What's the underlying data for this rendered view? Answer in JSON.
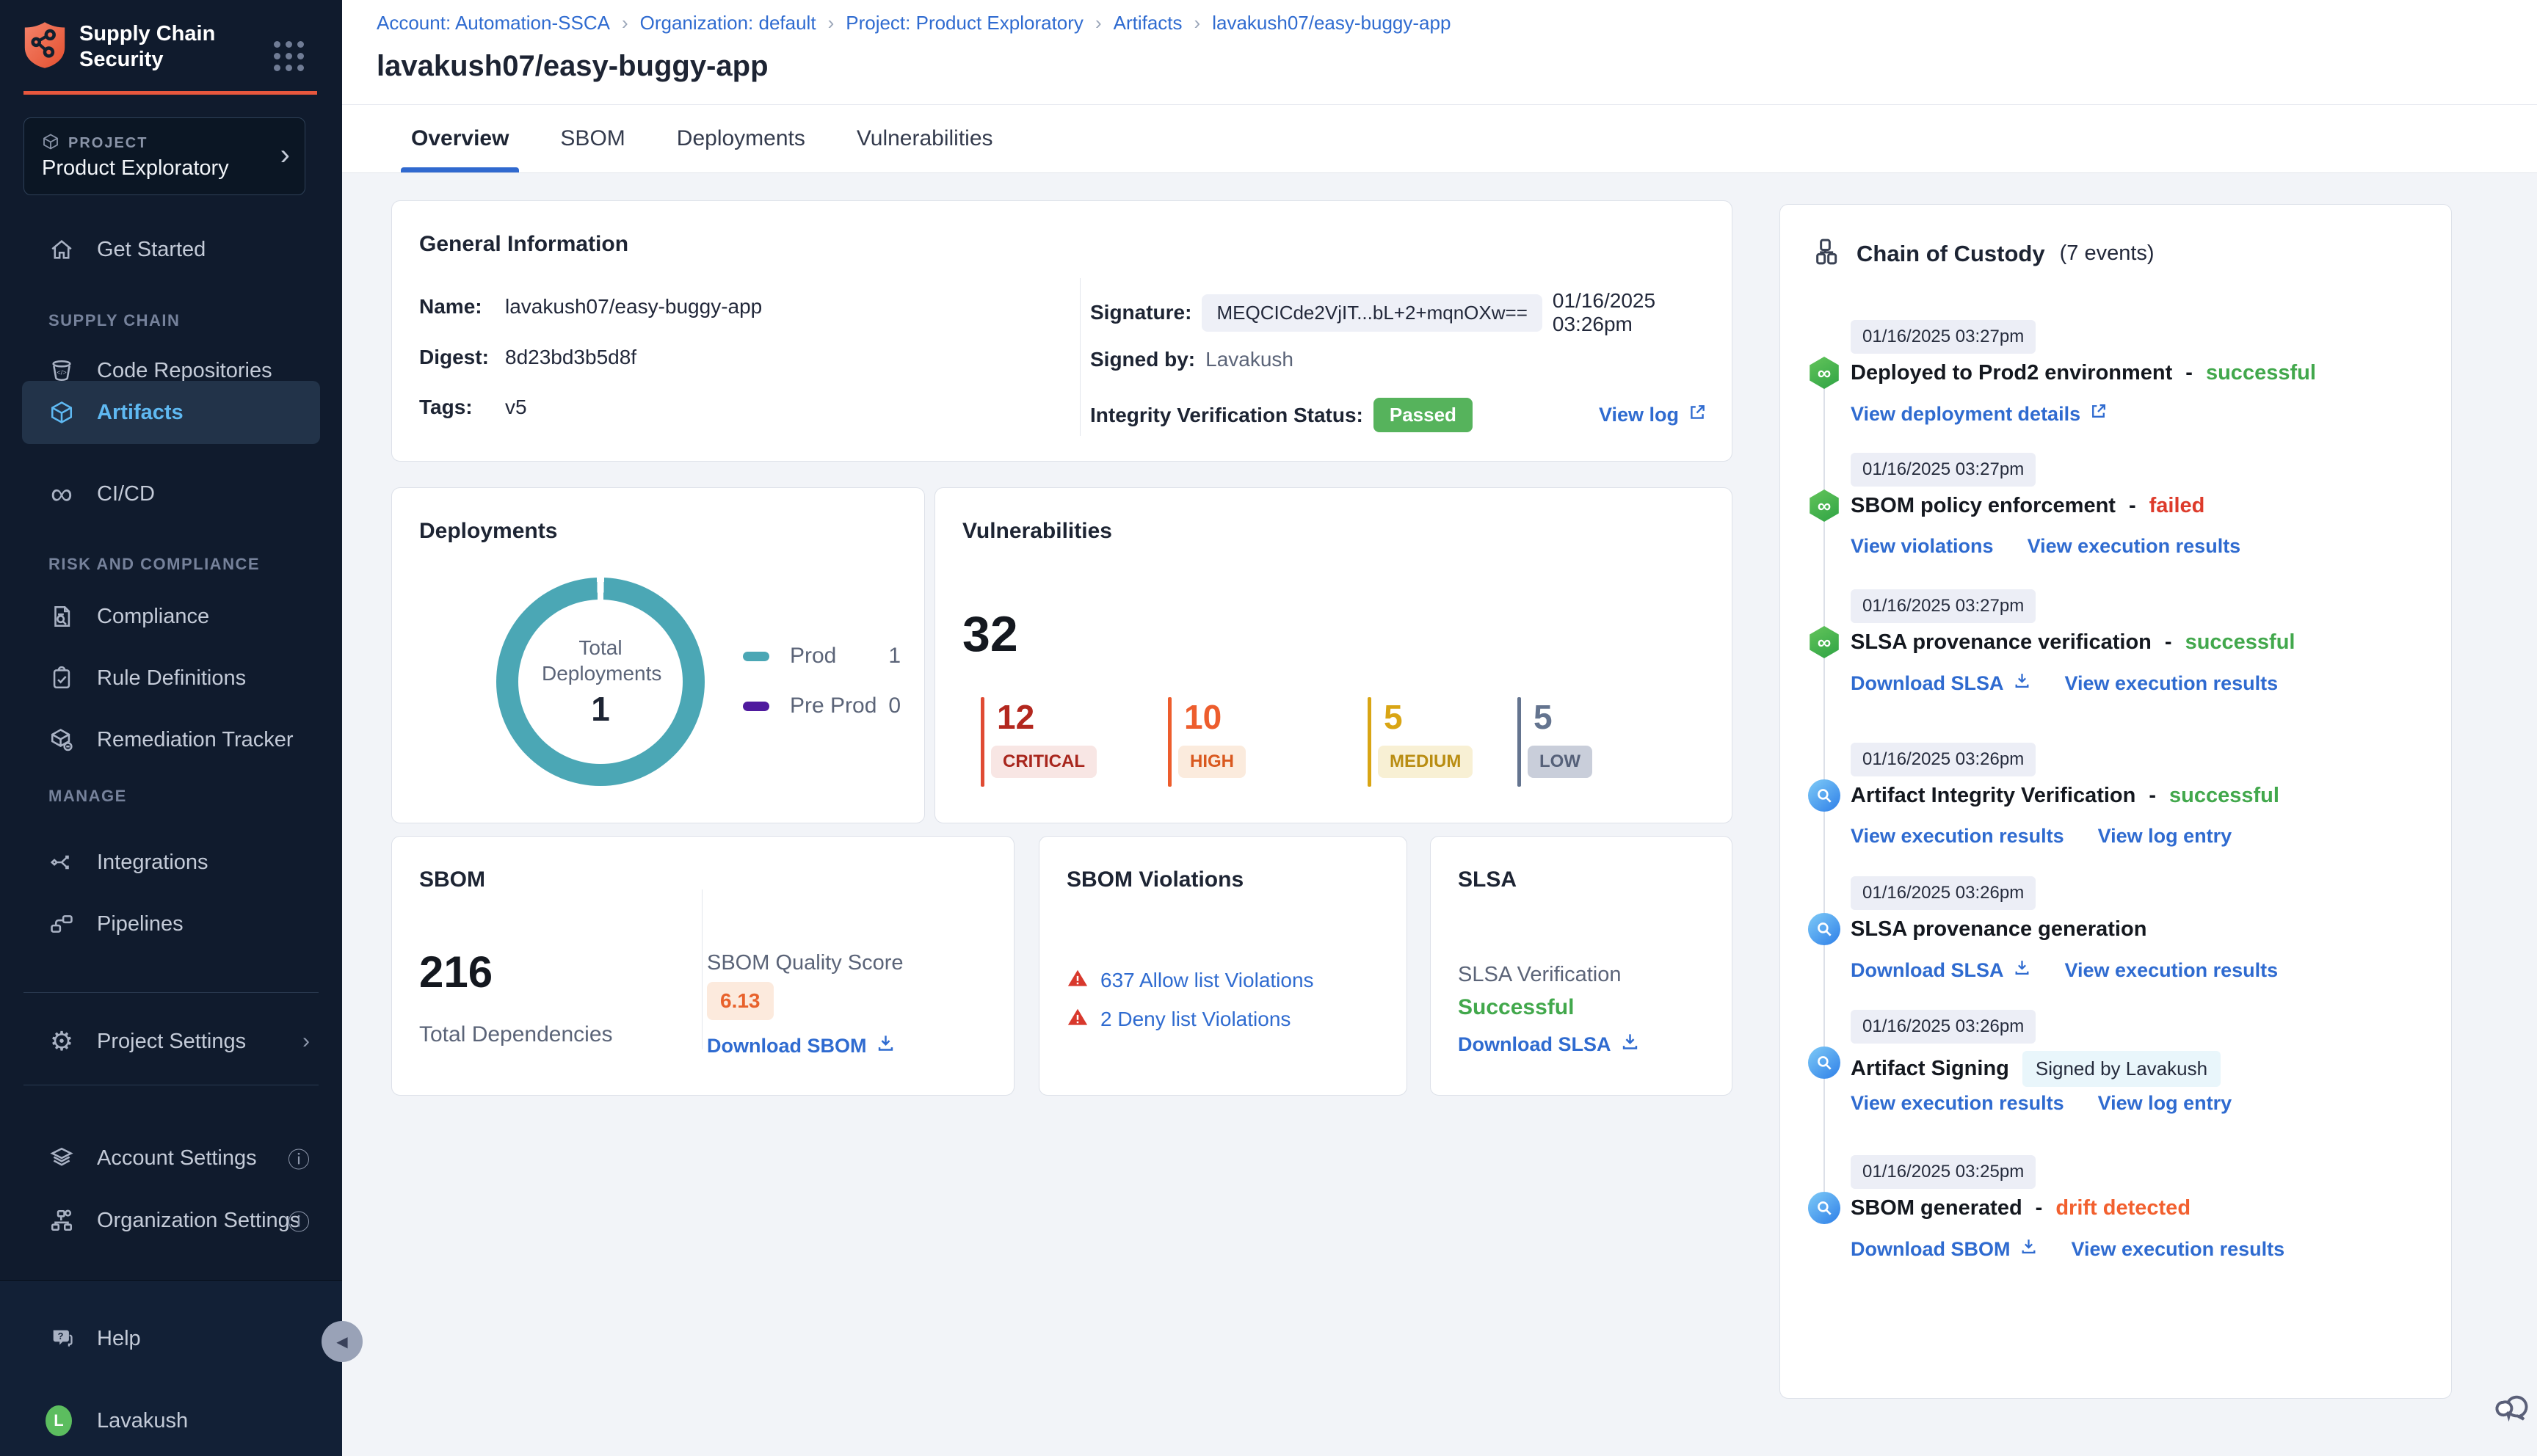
{
  "app": {
    "title_line1": "Supply Chain",
    "title_line2": "Security"
  },
  "sidebar": {
    "project": {
      "label": "PROJECT",
      "name": "Product Exploratory"
    },
    "nav": {
      "get_started": "Get Started",
      "section_supply_chain": "SUPPLY CHAIN",
      "code_repositories": "Code Repositories",
      "artifacts": "Artifacts",
      "cicd": "CI/CD",
      "section_risk": "RISK AND COMPLIANCE",
      "compliance": "Compliance",
      "rule_definitions": "Rule Definitions",
      "remediation_tracker": "Remediation Tracker",
      "section_manage": "MANAGE",
      "integrations": "Integrations",
      "pipelines": "Pipelines",
      "project_settings": "Project Settings",
      "account_settings": "Account Settings",
      "organization_settings": "Organization Settings",
      "help": "Help"
    },
    "user": {
      "name": "Lavakush",
      "initial": "L"
    }
  },
  "breadcrumb": {
    "items": [
      "Account: Automation-SSCA",
      "Organization: default",
      "Project: Product Exploratory",
      "Artifacts",
      "lavakush07/easy-buggy-app"
    ]
  },
  "page": {
    "title": "lavakush07/easy-buggy-app",
    "tabs": [
      "Overview",
      "SBOM",
      "Deployments",
      "Vulnerabilities"
    ],
    "active_tab": "Overview"
  },
  "general_info": {
    "title": "General Information",
    "name_label": "Name:",
    "name": "lavakush07/easy-buggy-app",
    "digest_label": "Digest:",
    "digest": "8d23bd3b5d8f",
    "tags_label": "Tags:",
    "tags": "v5",
    "signature_label": "Signature:",
    "signature": "MEQCICde2VjIT...bL+2+mqnOXw==",
    "signature_time": "01/16/2025 03:26pm",
    "signed_by_label": "Signed by:",
    "signed_by": "Lavakush",
    "integrity_label": "Integrity Verification Status:",
    "integrity_status": "Passed",
    "view_log": "View log"
  },
  "deployments": {
    "title": "Deployments",
    "center_label": "Total Deployments",
    "total": "1",
    "legend": [
      {
        "name": "Prod",
        "count": "1",
        "color": "#4BA7B5"
      },
      {
        "name": "Pre Prod",
        "count": "0",
        "color": "#4F1A9E"
      }
    ]
  },
  "vulnerabilities": {
    "title": "Vulnerabilities",
    "total": "32",
    "severities": [
      {
        "count": "12",
        "label": "CRITICAL",
        "color": "#B3271E"
      },
      {
        "count": "10",
        "label": "HIGH",
        "color": "#ED5D2D"
      },
      {
        "count": "5",
        "label": "MEDIUM",
        "color": "#D9A514"
      },
      {
        "count": "5",
        "label": "LOW",
        "color": "#64748F"
      }
    ]
  },
  "sbom": {
    "title": "SBOM",
    "total": "216",
    "total_label": "Total Dependencies",
    "quality_label": "SBOM Quality Score",
    "quality_score": "6.13",
    "download": "Download SBOM"
  },
  "sbom_violations": {
    "title": "SBOM Violations",
    "allow": "637 Allow list Violations",
    "deny": "2 Deny list Violations"
  },
  "slsa": {
    "title": "SLSA",
    "verification_label": "SLSA Verification",
    "status": "Successful",
    "download": "Download SLSA"
  },
  "chain": {
    "title": "Chain of Custody",
    "count": "(7 events)",
    "events": [
      {
        "time": "01/16/2025 03:27pm",
        "title": "Deployed to Prod2 environment",
        "status": "successful",
        "links": [
          {
            "label": "View deployment details"
          }
        ]
      },
      {
        "time": "01/16/2025 03:27pm",
        "title": "SBOM policy enforcement",
        "status": "failed",
        "links": [
          {
            "label": "View violations"
          },
          {
            "label": "View execution results"
          }
        ]
      },
      {
        "time": "01/16/2025 03:27pm",
        "title": "SLSA provenance verification",
        "status": "successful",
        "links": [
          {
            "label": "Download SLSA"
          },
          {
            "label": "View execution results"
          }
        ]
      },
      {
        "time": "01/16/2025 03:26pm",
        "title": "Artifact Integrity Verification",
        "status": "successful",
        "links": [
          {
            "label": "View execution results"
          },
          {
            "label": "View log entry"
          }
        ]
      },
      {
        "time": "01/16/2025 03:26pm",
        "title": "SLSA provenance generation",
        "status": "",
        "links": [
          {
            "label": "Download SLSA"
          },
          {
            "label": "View execution results"
          }
        ]
      },
      {
        "time": "01/16/2025 03:26pm",
        "title": "Artifact Signing",
        "badge": "Signed by Lavakush",
        "links": [
          {
            "label": "View execution results"
          },
          {
            "label": "View log entry"
          }
        ]
      },
      {
        "time": "01/16/2025 03:25pm",
        "title": "SBOM generated",
        "status": "drift detected",
        "links": [
          {
            "label": "Download SBOM"
          },
          {
            "label": "View execution results"
          }
        ]
      }
    ]
  },
  "colors": {
    "brand_orange": "#E8573D",
    "link_blue": "#2F6BD0",
    "success_green": "#42A84C",
    "fail_red": "#DD3B2B",
    "drift_orange": "#F2602F",
    "prod_teal": "#4BA7B5",
    "preprod_purple": "#4F1A9E",
    "passed_badge_green": "#56B35C",
    "active_nav_blue": "#5FB9F2"
  }
}
